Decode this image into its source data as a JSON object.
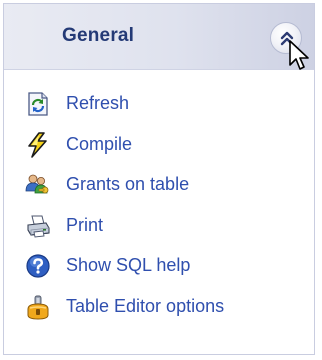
{
  "panel": {
    "title": "General",
    "collapse_icon": "chevron-up-double-icon",
    "items": [
      {
        "label": "Refresh",
        "icon": "refresh-icon"
      },
      {
        "label": "Compile",
        "icon": "lightning-icon"
      },
      {
        "label": "Grants on table",
        "icon": "users-key-icon"
      },
      {
        "label": "Print",
        "icon": "printer-icon"
      },
      {
        "label": "Show SQL help",
        "icon": "help-icon"
      },
      {
        "label": "Table Editor options",
        "icon": "options-icon"
      }
    ]
  },
  "colors": {
    "header_text": "#243a76",
    "link_text": "#2f4fae",
    "border": "#c9cde0"
  }
}
